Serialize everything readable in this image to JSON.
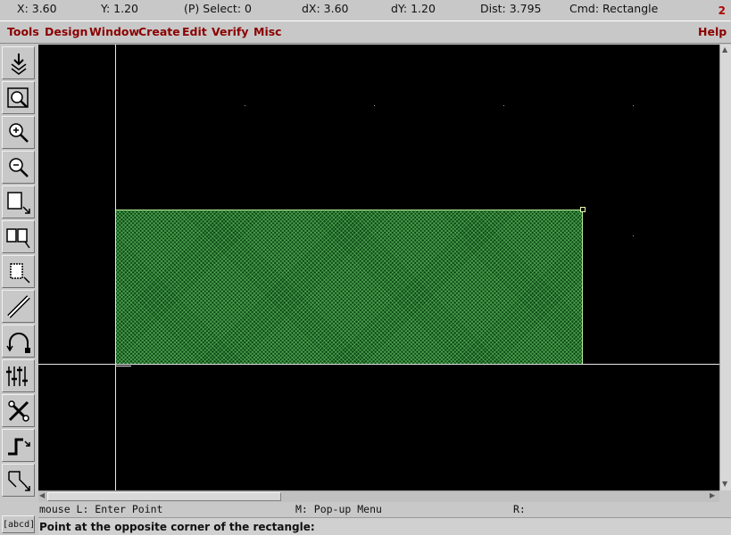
{
  "status": {
    "x": "X:  3.60",
    "y": "Y:  1.20",
    "select": "(P) Select: 0",
    "dx": "dX:  3.60",
    "dy": "dY:  1.20",
    "dist": "Dist: 3.795",
    "cmd": "Cmd: Rectangle",
    "window_number": "2"
  },
  "menu": {
    "tools": "Tools",
    "design": "Design",
    "window": "Window",
    "create": "Create",
    "edit": "Edit",
    "verify": "Verify",
    "misc": "Misc",
    "help": "Help"
  },
  "toolbar_icons": [
    "save-icon",
    "fit-icon",
    "zoom-in-icon",
    "zoom-out-icon",
    "stretch-icon",
    "copy-icon",
    "move-icon",
    "path-icon",
    "undo-icon",
    "properties-icon",
    "tools-icon",
    "wire-icon",
    "polygon-icon"
  ],
  "canvas": {
    "background": "#000000",
    "shape_fill": "#0b4a14",
    "shape_outline": "#b8f09a"
  },
  "mouse": {
    "left": "mouse L: Enter Point",
    "middle": "M: Pop-up Menu",
    "right": "R:"
  },
  "prompt": "Point at the opposite corner of the rectangle:",
  "abcd_label": "[abcd]"
}
